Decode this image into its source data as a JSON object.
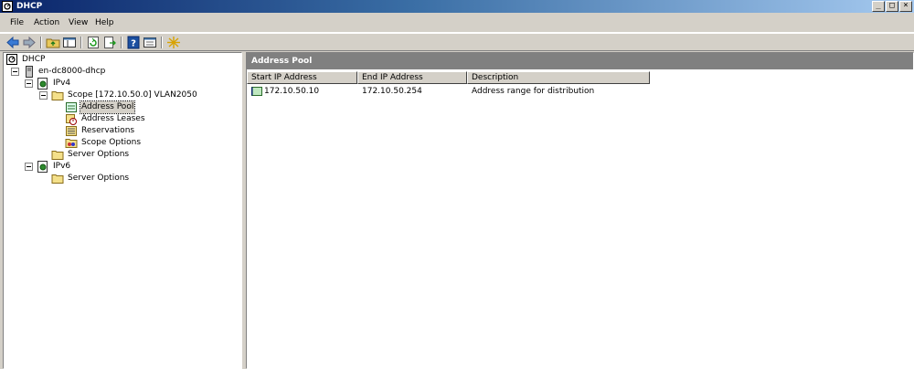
{
  "window": {
    "title": "DHCP",
    "buttons": [
      "_",
      "□",
      "×"
    ]
  },
  "menu": [
    "File",
    "Action",
    "View",
    "Help"
  ],
  "toolbar": {
    "icons": [
      "back-arrow-icon",
      "forward-arrow-icon",
      "up-folder-icon",
      "show-hide-console-tree-icon",
      "refresh-icon",
      "export-list-icon",
      "help-icon",
      "properties-icon",
      "new-item-icon"
    ]
  },
  "tree": {
    "root": "DHCP",
    "server": "en-dc8000-dhcp",
    "ipv4": "IPv4",
    "scope": "Scope [172.10.50.0] VLAN2050",
    "address_pool": "Address Pool",
    "address_leases": "Address Leases",
    "reservations": "Reservations",
    "scope_options": "Scope Options",
    "server_options_v4": "Server Options",
    "ipv6": "IPv6",
    "server_options_v6": "Server Options"
  },
  "detail": {
    "header": "Address Pool",
    "columns": [
      "Start IP Address",
      "End IP Address",
      "Description"
    ],
    "rows": [
      {
        "start": "172.10.50.10",
        "end": "172.10.50.254",
        "description": "Address range for distribution"
      }
    ]
  }
}
